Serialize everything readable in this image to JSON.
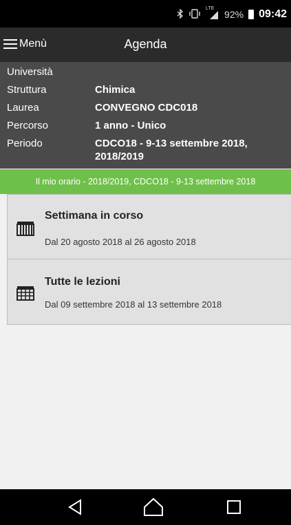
{
  "status_bar": {
    "battery": "92%",
    "time": "09:42",
    "signal_label": "LTE",
    "icons": [
      "bluetooth-icon",
      "vibrate-icon",
      "signal-icon",
      "battery-icon"
    ]
  },
  "app_bar": {
    "menu_label": "Menù",
    "title": "Agenda"
  },
  "info": [
    {
      "key": "Università",
      "value": ""
    },
    {
      "key": "Struttura",
      "value": "Chimica"
    },
    {
      "key": "Laurea",
      "value": "CONVEGNO CDC018"
    },
    {
      "key": "Percorso",
      "value": "1 anno - Unico"
    },
    {
      "key": "Periodo",
      "value": "CDCO18 -  9-13 settembre 2018,",
      "value2": "2018/2019"
    }
  ],
  "banner": "Il mio orario - 2018/2019, CDCO18 -  9-13 settembre 2018",
  "cards": [
    {
      "title": "Settimana in corso",
      "subtitle": "Dal 20 agosto 2018 al 26 agosto 2018",
      "icon": "week-calendar-icon"
    },
    {
      "title": "Tutte le lezioni",
      "subtitle": "Dal 09 settembre 2018 al 13 settembre 2018",
      "icon": "month-calendar-icon"
    }
  ],
  "colors": {
    "banner": "#6fc04a",
    "appbar": "#2b2b2b",
    "info": "#4a4a4a",
    "card": "#e1e1e1"
  },
  "nav": [
    "back-icon",
    "home-icon",
    "recents-icon"
  ]
}
